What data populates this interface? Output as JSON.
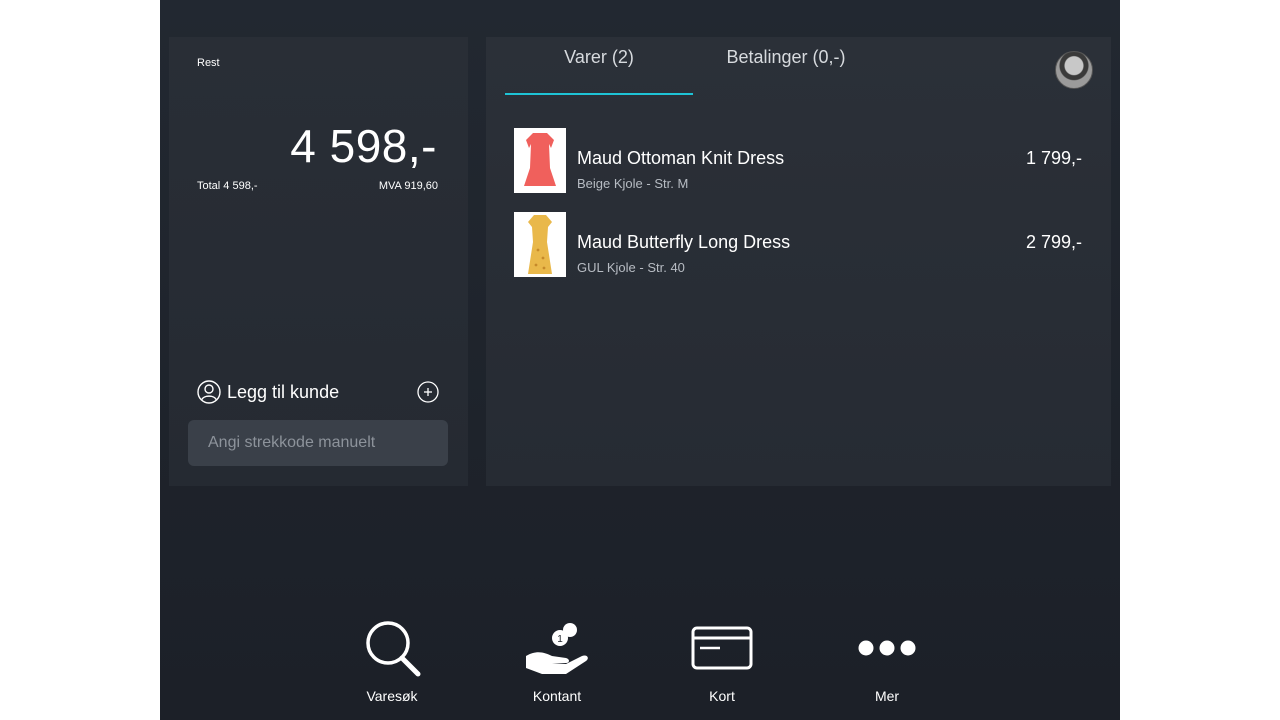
{
  "summary": {
    "rest_label": "Rest",
    "amount": "4 598,-",
    "total": "Total 4 598,-",
    "vat": "MVA 919,60"
  },
  "customer": {
    "add_label": "Legg til kunde",
    "person_icon": "person-icon",
    "add_icon": "plus-circle-icon"
  },
  "barcode": {
    "placeholder": "Angi strekkode manuelt"
  },
  "tabs": [
    {
      "label": "Varer (2)",
      "active": true
    },
    {
      "label": "Betalinger (0,-)",
      "active": false
    }
  ],
  "accent_color": "#1ec3d6",
  "items": [
    {
      "name": "Maud Ottoman Knit Dress",
      "subtitle": "Beige Kjole - Str. M",
      "price": "1 799,-",
      "thumb_color": "#f0605c"
    },
    {
      "name": "Maud Butterfly Long Dress",
      "subtitle": "GUL Kjole - Str. 40",
      "price": "2 799,-",
      "thumb_color": "#e9b84a"
    }
  ],
  "toolbar": [
    {
      "label": "Varesøk",
      "icon": "magnifier-icon"
    },
    {
      "label": "Kontant",
      "icon": "hand-coins-icon"
    },
    {
      "label": "Kort",
      "icon": "credit-card-icon"
    },
    {
      "label": "Mer",
      "icon": "more-dots-icon"
    }
  ]
}
